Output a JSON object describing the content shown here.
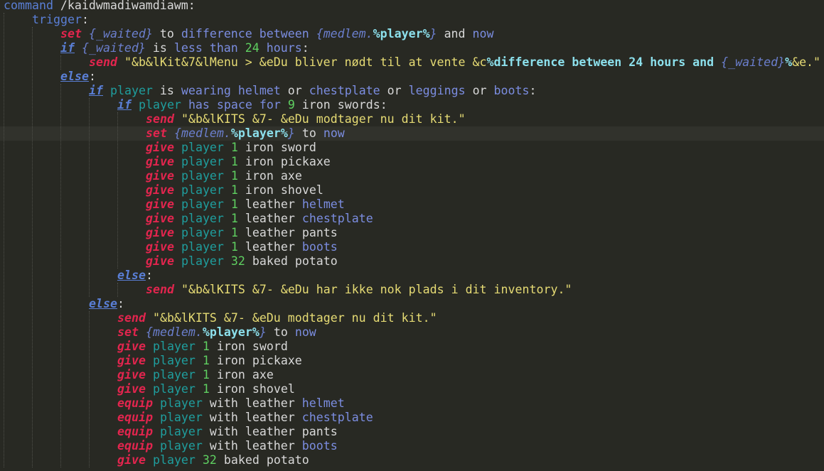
{
  "editor": {
    "colors": {
      "background": "#282923",
      "current_line": "#31322c",
      "keyword": "#7b8de0",
      "effect": "#e2254e",
      "string": "#e6db74",
      "number": "#5fd061",
      "player": "#1f9e9e",
      "variable_bold": "#8ce0ec"
    },
    "current_line_index": 9,
    "lines": [
      {
        "indent": 0,
        "tokens": [
          {
            "t": "command",
            "c": "k-cmd"
          },
          {
            "t": " /kaidwmadiwamdiawm:",
            "c": "k-norm"
          }
        ]
      },
      {
        "indent": 1,
        "tokens": [
          {
            "t": "trigger",
            "c": "k-trig"
          },
          {
            "t": ":",
            "c": "k-norm"
          }
        ]
      },
      {
        "indent": 2,
        "tokens": [
          {
            "t": "set",
            "c": "k-effect"
          },
          {
            "t": " ",
            "c": "k-norm"
          },
          {
            "t": "{_waited}",
            "c": "k-var"
          },
          {
            "t": " to ",
            "c": "k-norm"
          },
          {
            "t": "difference between",
            "c": "k-kw"
          },
          {
            "t": " ",
            "c": "k-norm"
          },
          {
            "t": "{medlem.",
            "c": "k-var"
          },
          {
            "t": "%player%",
            "c": "k-varb"
          },
          {
            "t": "}",
            "c": "k-var"
          },
          {
            "t": " and ",
            "c": "k-norm"
          },
          {
            "t": "now",
            "c": "k-kw"
          }
        ]
      },
      {
        "indent": 2,
        "tokens": [
          {
            "t": "if",
            "c": "k-if"
          },
          {
            "t": " ",
            "c": "k-norm"
          },
          {
            "t": "{_waited}",
            "c": "k-var"
          },
          {
            "t": " is ",
            "c": "k-norm"
          },
          {
            "t": "less than",
            "c": "k-kw"
          },
          {
            "t": " ",
            "c": "k-norm"
          },
          {
            "t": "24",
            "c": "k-num"
          },
          {
            "t": " ",
            "c": "k-norm"
          },
          {
            "t": "hours",
            "c": "k-kw"
          },
          {
            "t": ":",
            "c": "k-norm"
          }
        ]
      },
      {
        "indent": 3,
        "tokens": [
          {
            "t": "send",
            "c": "k-effect"
          },
          {
            "t": " \"&b&lKit&7&lMenu > &eDu bliver nødt til at vente &c",
            "c": "k-str"
          },
          {
            "t": "%difference between 24 hours and ",
            "c": "k-strb"
          },
          {
            "t": "{_waited}",
            "c": "k-strv"
          },
          {
            "t": "%",
            "c": "k-strb"
          },
          {
            "t": "&e.\"",
            "c": "k-str"
          }
        ]
      },
      {
        "indent": 2,
        "tokens": [
          {
            "t": "else",
            "c": "k-if"
          },
          {
            "t": ":",
            "c": "k-norm"
          }
        ]
      },
      {
        "indent": 3,
        "tokens": [
          {
            "t": "if",
            "c": "k-if"
          },
          {
            "t": " ",
            "c": "k-norm"
          },
          {
            "t": "player",
            "c": "k-player"
          },
          {
            "t": " is ",
            "c": "k-norm"
          },
          {
            "t": "wearing",
            "c": "k-kw"
          },
          {
            "t": " ",
            "c": "k-norm"
          },
          {
            "t": "helmet",
            "c": "k-item"
          },
          {
            "t": " or ",
            "c": "k-norm"
          },
          {
            "t": "chestplate",
            "c": "k-item"
          },
          {
            "t": " or ",
            "c": "k-norm"
          },
          {
            "t": "leggings",
            "c": "k-item"
          },
          {
            "t": " or ",
            "c": "k-norm"
          },
          {
            "t": "boots",
            "c": "k-item"
          },
          {
            "t": ":",
            "c": "k-norm"
          }
        ]
      },
      {
        "indent": 4,
        "tokens": [
          {
            "t": "if",
            "c": "k-if"
          },
          {
            "t": " ",
            "c": "k-norm"
          },
          {
            "t": "player",
            "c": "k-player"
          },
          {
            "t": " ",
            "c": "k-norm"
          },
          {
            "t": "has space for",
            "c": "k-kw"
          },
          {
            "t": " ",
            "c": "k-norm"
          },
          {
            "t": "9",
            "c": "k-num"
          },
          {
            "t": " iron swords:",
            "c": "k-norm"
          }
        ]
      },
      {
        "indent": 5,
        "tokens": [
          {
            "t": "send",
            "c": "k-effect"
          },
          {
            "t": " \"&b&lKITS &7- &eDu modtager nu dit kit.\"",
            "c": "k-str"
          }
        ]
      },
      {
        "indent": 5,
        "tokens": [
          {
            "t": "set",
            "c": "k-effect"
          },
          {
            "t": " ",
            "c": "k-norm"
          },
          {
            "t": "{medlem.",
            "c": "k-var"
          },
          {
            "t": "%player%",
            "c": "k-varb"
          },
          {
            "t": "}",
            "c": "k-var"
          },
          {
            "t": " to ",
            "c": "k-norm"
          },
          {
            "t": "now",
            "c": "k-kw"
          }
        ]
      },
      {
        "indent": 5,
        "tokens": [
          {
            "t": "give",
            "c": "k-effect"
          },
          {
            "t": " ",
            "c": "k-norm"
          },
          {
            "t": "player",
            "c": "k-player"
          },
          {
            "t": " ",
            "c": "k-norm"
          },
          {
            "t": "1",
            "c": "k-num"
          },
          {
            "t": " iron sword",
            "c": "k-norm"
          }
        ]
      },
      {
        "indent": 5,
        "tokens": [
          {
            "t": "give",
            "c": "k-effect"
          },
          {
            "t": " ",
            "c": "k-norm"
          },
          {
            "t": "player",
            "c": "k-player"
          },
          {
            "t": " ",
            "c": "k-norm"
          },
          {
            "t": "1",
            "c": "k-num"
          },
          {
            "t": " iron pickaxe",
            "c": "k-norm"
          }
        ]
      },
      {
        "indent": 5,
        "tokens": [
          {
            "t": "give",
            "c": "k-effect"
          },
          {
            "t": " ",
            "c": "k-norm"
          },
          {
            "t": "player",
            "c": "k-player"
          },
          {
            "t": " ",
            "c": "k-norm"
          },
          {
            "t": "1",
            "c": "k-num"
          },
          {
            "t": " iron axe",
            "c": "k-norm"
          }
        ]
      },
      {
        "indent": 5,
        "tokens": [
          {
            "t": "give",
            "c": "k-effect"
          },
          {
            "t": " ",
            "c": "k-norm"
          },
          {
            "t": "player",
            "c": "k-player"
          },
          {
            "t": " ",
            "c": "k-norm"
          },
          {
            "t": "1",
            "c": "k-num"
          },
          {
            "t": " iron shovel",
            "c": "k-norm"
          }
        ]
      },
      {
        "indent": 5,
        "tokens": [
          {
            "t": "give",
            "c": "k-effect"
          },
          {
            "t": " ",
            "c": "k-norm"
          },
          {
            "t": "player",
            "c": "k-player"
          },
          {
            "t": " ",
            "c": "k-norm"
          },
          {
            "t": "1",
            "c": "k-num"
          },
          {
            "t": " leather ",
            "c": "k-norm"
          },
          {
            "t": "helmet",
            "c": "k-item"
          }
        ]
      },
      {
        "indent": 5,
        "tokens": [
          {
            "t": "give",
            "c": "k-effect"
          },
          {
            "t": " ",
            "c": "k-norm"
          },
          {
            "t": "player",
            "c": "k-player"
          },
          {
            "t": " ",
            "c": "k-norm"
          },
          {
            "t": "1",
            "c": "k-num"
          },
          {
            "t": " leather ",
            "c": "k-norm"
          },
          {
            "t": "chestplate",
            "c": "k-item"
          }
        ]
      },
      {
        "indent": 5,
        "tokens": [
          {
            "t": "give",
            "c": "k-effect"
          },
          {
            "t": " ",
            "c": "k-norm"
          },
          {
            "t": "player",
            "c": "k-player"
          },
          {
            "t": " ",
            "c": "k-norm"
          },
          {
            "t": "1",
            "c": "k-num"
          },
          {
            "t": " leather pants",
            "c": "k-norm"
          }
        ]
      },
      {
        "indent": 5,
        "tokens": [
          {
            "t": "give",
            "c": "k-effect"
          },
          {
            "t": " ",
            "c": "k-norm"
          },
          {
            "t": "player",
            "c": "k-player"
          },
          {
            "t": " ",
            "c": "k-norm"
          },
          {
            "t": "1",
            "c": "k-num"
          },
          {
            "t": " leather ",
            "c": "k-norm"
          },
          {
            "t": "boots",
            "c": "k-item"
          }
        ]
      },
      {
        "indent": 5,
        "tokens": [
          {
            "t": "give",
            "c": "k-effect"
          },
          {
            "t": " ",
            "c": "k-norm"
          },
          {
            "t": "player",
            "c": "k-player"
          },
          {
            "t": " ",
            "c": "k-norm"
          },
          {
            "t": "32",
            "c": "k-num"
          },
          {
            "t": " baked potato",
            "c": "k-norm"
          }
        ]
      },
      {
        "indent": 4,
        "tokens": [
          {
            "t": "else",
            "c": "k-if"
          },
          {
            "t": ":",
            "c": "k-norm"
          }
        ]
      },
      {
        "indent": 5,
        "tokens": [
          {
            "t": "send",
            "c": "k-effect"
          },
          {
            "t": " \"&b&lKITS &7- &eDu har ikke nok plads i dit inventory.\"",
            "c": "k-str"
          }
        ]
      },
      {
        "indent": 3,
        "tokens": [
          {
            "t": "else",
            "c": "k-if"
          },
          {
            "t": ":",
            "c": "k-norm"
          }
        ]
      },
      {
        "indent": 4,
        "tokens": [
          {
            "t": "send",
            "c": "k-effect"
          },
          {
            "t": " \"&b&lKITS &7- &eDu modtager nu dit kit.\"",
            "c": "k-str"
          }
        ]
      },
      {
        "indent": 4,
        "tokens": [
          {
            "t": "set",
            "c": "k-effect"
          },
          {
            "t": " ",
            "c": "k-norm"
          },
          {
            "t": "{medlem.",
            "c": "k-var"
          },
          {
            "t": "%player%",
            "c": "k-varb"
          },
          {
            "t": "}",
            "c": "k-var"
          },
          {
            "t": " to ",
            "c": "k-norm"
          },
          {
            "t": "now",
            "c": "k-kw"
          }
        ]
      },
      {
        "indent": 4,
        "tokens": [
          {
            "t": "give",
            "c": "k-effect"
          },
          {
            "t": " ",
            "c": "k-norm"
          },
          {
            "t": "player",
            "c": "k-player"
          },
          {
            "t": " ",
            "c": "k-norm"
          },
          {
            "t": "1",
            "c": "k-num"
          },
          {
            "t": " iron sword",
            "c": "k-norm"
          }
        ]
      },
      {
        "indent": 4,
        "tokens": [
          {
            "t": "give",
            "c": "k-effect"
          },
          {
            "t": " ",
            "c": "k-norm"
          },
          {
            "t": "player",
            "c": "k-player"
          },
          {
            "t": " ",
            "c": "k-norm"
          },
          {
            "t": "1",
            "c": "k-num"
          },
          {
            "t": " iron pickaxe",
            "c": "k-norm"
          }
        ]
      },
      {
        "indent": 4,
        "tokens": [
          {
            "t": "give",
            "c": "k-effect"
          },
          {
            "t": " ",
            "c": "k-norm"
          },
          {
            "t": "player",
            "c": "k-player"
          },
          {
            "t": " ",
            "c": "k-norm"
          },
          {
            "t": "1",
            "c": "k-num"
          },
          {
            "t": " iron axe",
            "c": "k-norm"
          }
        ]
      },
      {
        "indent": 4,
        "tokens": [
          {
            "t": "give",
            "c": "k-effect"
          },
          {
            "t": " ",
            "c": "k-norm"
          },
          {
            "t": "player",
            "c": "k-player"
          },
          {
            "t": " ",
            "c": "k-norm"
          },
          {
            "t": "1",
            "c": "k-num"
          },
          {
            "t": " iron shovel",
            "c": "k-norm"
          }
        ]
      },
      {
        "indent": 4,
        "tokens": [
          {
            "t": "equip",
            "c": "k-effect"
          },
          {
            "t": " ",
            "c": "k-norm"
          },
          {
            "t": "player",
            "c": "k-player"
          },
          {
            "t": " with leather ",
            "c": "k-norm"
          },
          {
            "t": "helmet",
            "c": "k-item"
          }
        ]
      },
      {
        "indent": 4,
        "tokens": [
          {
            "t": "equip",
            "c": "k-effect"
          },
          {
            "t": " ",
            "c": "k-norm"
          },
          {
            "t": "player",
            "c": "k-player"
          },
          {
            "t": " with leather ",
            "c": "k-norm"
          },
          {
            "t": "chestplate",
            "c": "k-item"
          }
        ]
      },
      {
        "indent": 4,
        "tokens": [
          {
            "t": "equip",
            "c": "k-effect"
          },
          {
            "t": " ",
            "c": "k-norm"
          },
          {
            "t": "player",
            "c": "k-player"
          },
          {
            "t": " with leather pants",
            "c": "k-norm"
          }
        ]
      },
      {
        "indent": 4,
        "tokens": [
          {
            "t": "equip",
            "c": "k-effect"
          },
          {
            "t": " ",
            "c": "k-norm"
          },
          {
            "t": "player",
            "c": "k-player"
          },
          {
            "t": " with leather ",
            "c": "k-norm"
          },
          {
            "t": "boots",
            "c": "k-item"
          }
        ]
      },
      {
        "indent": 4,
        "tokens": [
          {
            "t": "give",
            "c": "k-effect"
          },
          {
            "t": " ",
            "c": "k-norm"
          },
          {
            "t": "player",
            "c": "k-player"
          },
          {
            "t": " ",
            "c": "k-norm"
          },
          {
            "t": "32",
            "c": "k-num"
          },
          {
            "t": " baked potato",
            "c": "k-norm"
          }
        ]
      }
    ]
  }
}
